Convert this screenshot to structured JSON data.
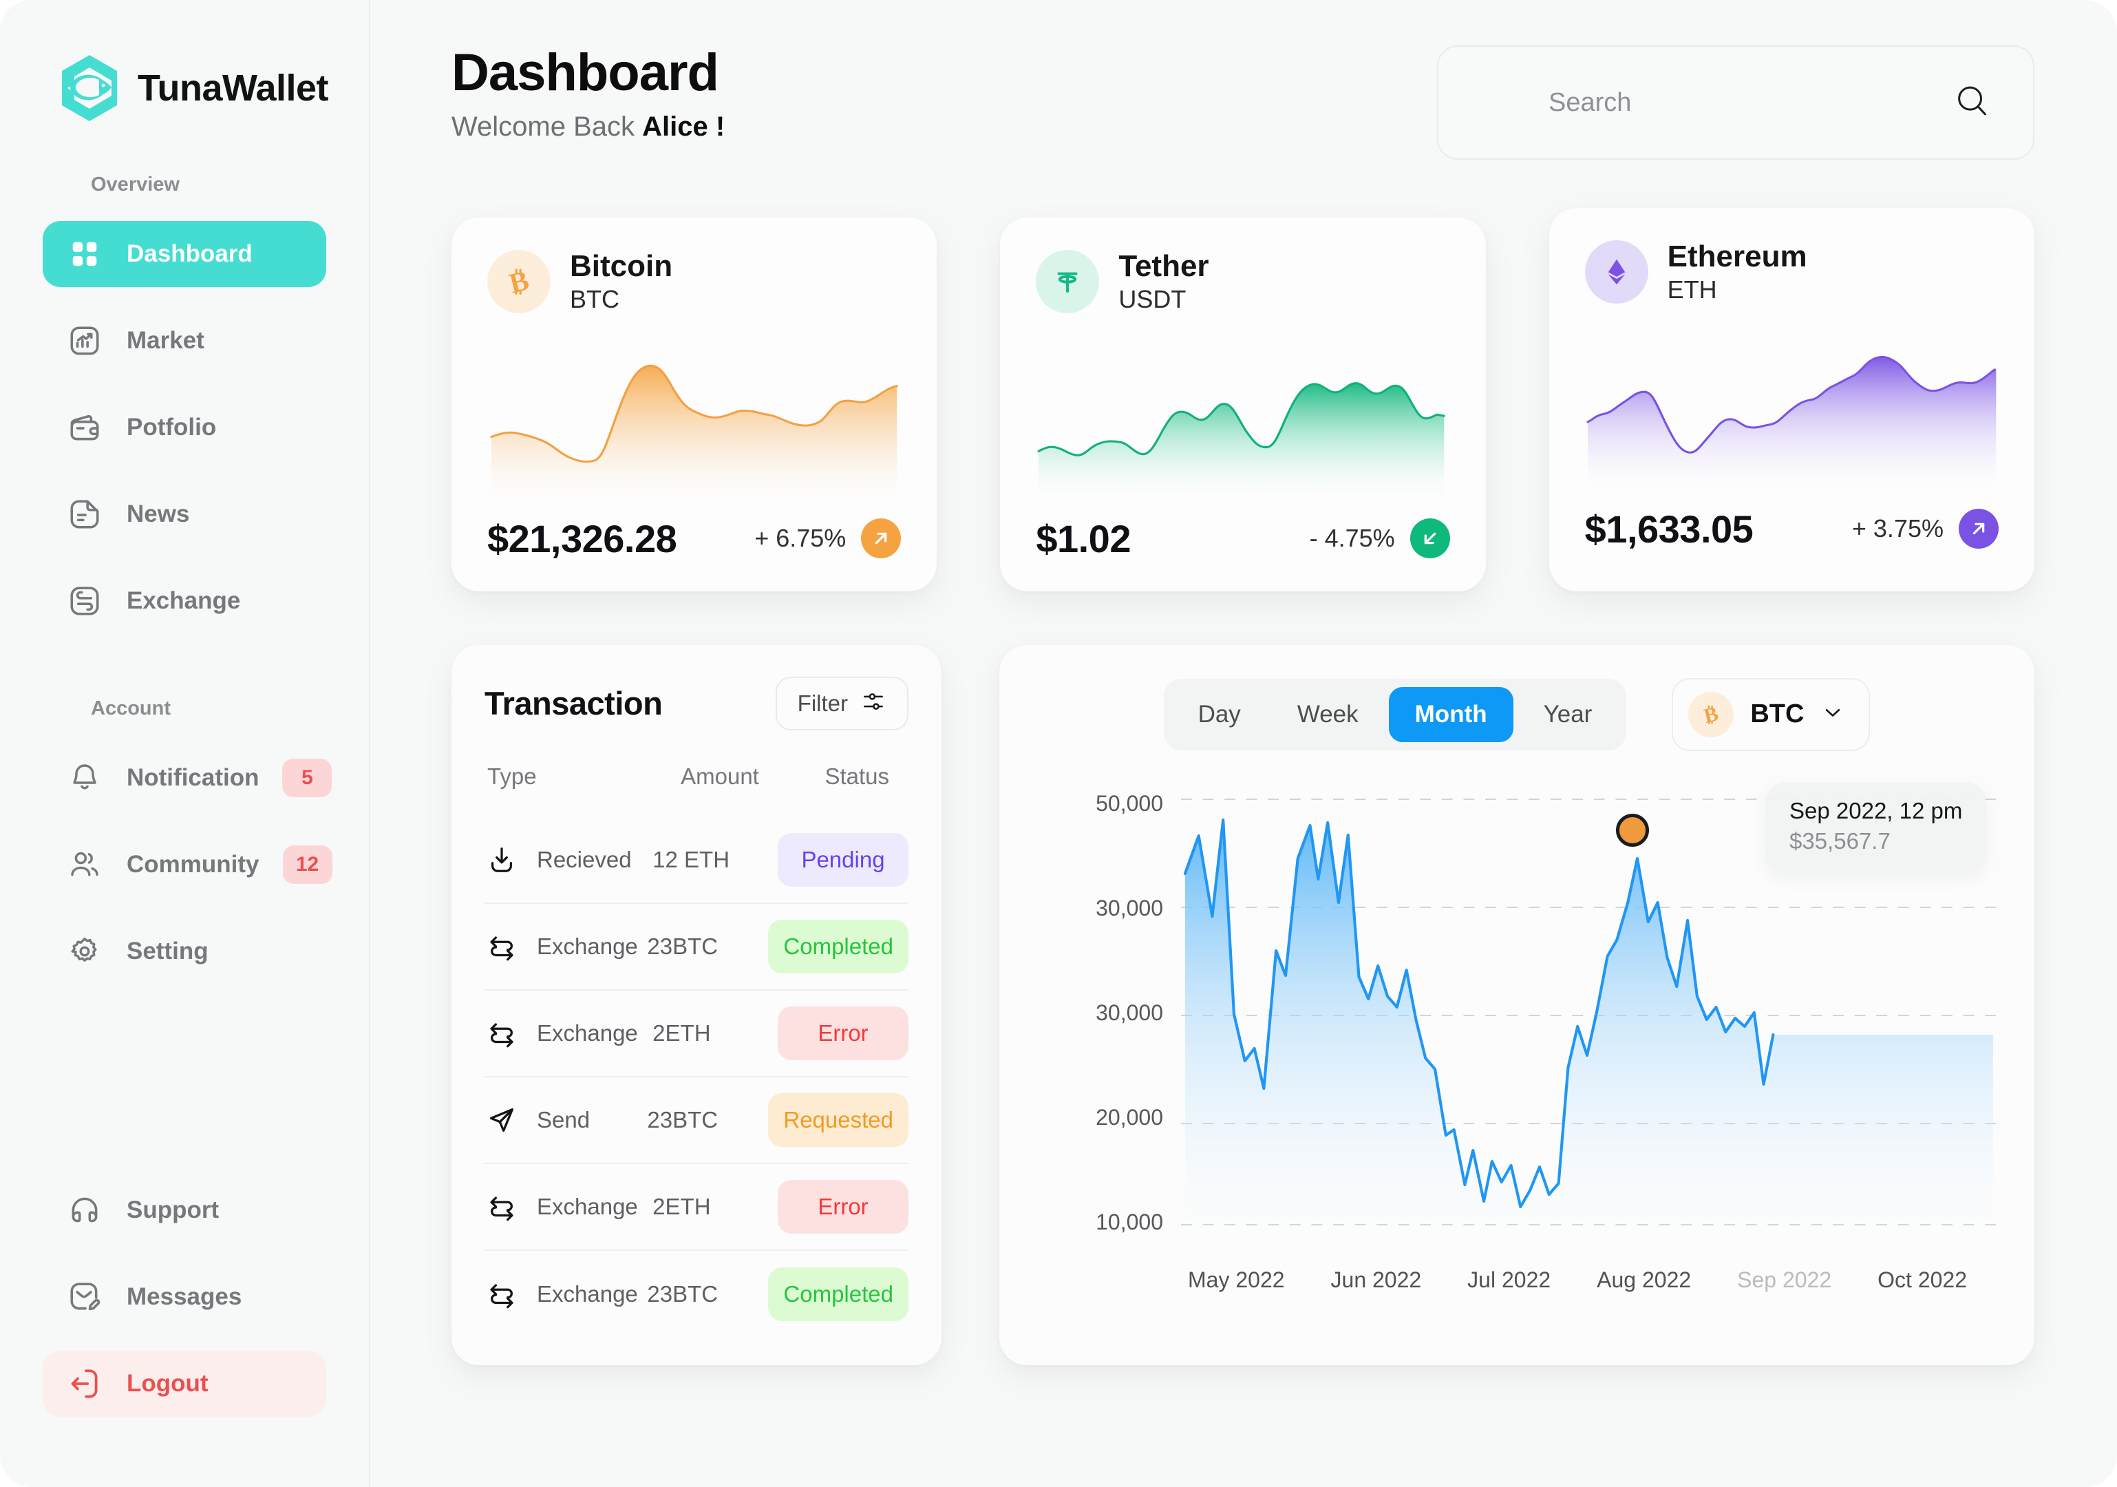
{
  "brand": {
    "name": "TunaWallet",
    "accent": "#45ddd2"
  },
  "sidebar": {
    "overview_label": "Overview",
    "account_label": "Account",
    "overview_items": [
      {
        "label": "Dashboard",
        "icon": "grid-icon",
        "active": true
      },
      {
        "label": "Market",
        "icon": "chart-square-icon",
        "active": false
      },
      {
        "label": "Potfolio",
        "icon": "wallet-icon",
        "active": false
      },
      {
        "label": "News",
        "icon": "document-icon",
        "active": false
      },
      {
        "label": "Exchange",
        "icon": "exchange-square-icon",
        "active": false
      }
    ],
    "account_items": [
      {
        "label": "Notification",
        "icon": "bell-icon",
        "badge": "5"
      },
      {
        "label": "Community",
        "icon": "users-icon",
        "badge": "12"
      },
      {
        "label": "Setting",
        "icon": "gear-icon",
        "badge": ""
      }
    ],
    "bottom_items": [
      {
        "label": "Support",
        "icon": "headphones-icon"
      },
      {
        "label": "Messages",
        "icon": "message-edit-icon"
      },
      {
        "label": "Logout",
        "icon": "logout-icon"
      }
    ]
  },
  "header": {
    "title": "Dashboard",
    "welcome_prefix": "Welcome Back ",
    "user_name": "Alice !",
    "search_placeholder": "Search",
    "search_value": ""
  },
  "coins": [
    {
      "name": "Bitcoin",
      "symbol": "BTC",
      "icon": "bitcoin-icon",
      "price": "$21,326.28",
      "change": "+ 6.75%",
      "direction": "up",
      "color": "#f5a köp",
      "accent": "#f6a council"
    },
    {
      "name": "Tether",
      "symbol": "USDT",
      "icon": "tether-icon",
      "price": "$1.02",
      "change": "- 4.75%",
      "direction": "down",
      "accent": "#0fb87b"
    },
    {
      "name": "Ethereum",
      "symbol": "ETH",
      "icon": "ethereum-icon",
      "price": "$1,633.05",
      "change": "+ 3.75%",
      "direction": "up",
      "accent": "#7a52e4"
    }
  ],
  "transactions": {
    "title": "Transaction",
    "filter_label": "Filter",
    "columns": [
      "Type",
      "Amount",
      "Status"
    ],
    "rows": [
      {
        "icon": "download-icon",
        "type": "Recieved",
        "amount": "12 ETH",
        "status": "Pending",
        "status_class": "pending"
      },
      {
        "icon": "swap-icon",
        "type": "Exchange",
        "amount": "23BTC",
        "status": "Completed",
        "status_class": "completed"
      },
      {
        "icon": "swap-icon",
        "type": "Exchange",
        "amount": "2ETH",
        "status": "Error",
        "status_class": "error"
      },
      {
        "icon": "send-icon",
        "type": "Send",
        "amount": "23BTC",
        "status": "Requested",
        "status_class": "requested"
      },
      {
        "icon": "swap-icon",
        "type": "Exchange",
        "amount": "2ETH",
        "status": "Error",
        "status_class": "error"
      },
      {
        "icon": "swap-icon",
        "type": "Exchange",
        "amount": "23BTC",
        "status": "Completed",
        "status_class": "completed"
      }
    ]
  },
  "chart_controls": {
    "ranges": [
      "Day",
      "Week",
      "Month",
      "Year"
    ],
    "active_range": "Month",
    "selected_coin": "BTC",
    "coin_icon": "bitcoin-icon",
    "chevron": "chevron-down-icon"
  },
  "chart_data": {
    "type": "area",
    "title": "",
    "xlabel": "",
    "ylabel": "",
    "line_color": "#2196f3",
    "grid": true,
    "ytick_labels": [
      "50,000",
      "30,000",
      "30,000",
      "20,000",
      "10,000"
    ],
    "ylim": [
      10000,
      50000
    ],
    "xtick_labels": [
      "May 2022",
      "Jun 2022",
      "Jul 2022",
      "Aug 2022",
      "Sep 2022",
      "Oct 2022"
    ],
    "highlighted_xtick": "Sep 2022",
    "tooltip": {
      "date": "Sep 2022, 12 pm",
      "value": "$35,567.7"
    },
    "marker": {
      "x_label": "Sep 2022",
      "value": 35567.7,
      "color": "#f09a3e"
    },
    "values": [
      42500,
      45200,
      38000,
      46800,
      33500,
      30600,
      31200,
      29200,
      35500,
      33800,
      40500,
      45600,
      41200,
      46600,
      39800,
      45300,
      33800,
      32100,
      34900,
      32300,
      31400,
      34200,
      30200,
      27600,
      26900,
      22800,
      23100,
      19200,
      21400,
      18300,
      20900,
      19500,
      20600,
      18100,
      19000,
      20500,
      18400,
      19100,
      23200,
      25600,
      24100,
      26700,
      29800,
      30900,
      33200,
      35568,
      32100,
      33400,
      30200,
      28900,
      33100,
      28500,
      27200,
      27900,
      26600,
      27400,
      26900,
      27600,
      24100,
      26800
    ]
  }
}
